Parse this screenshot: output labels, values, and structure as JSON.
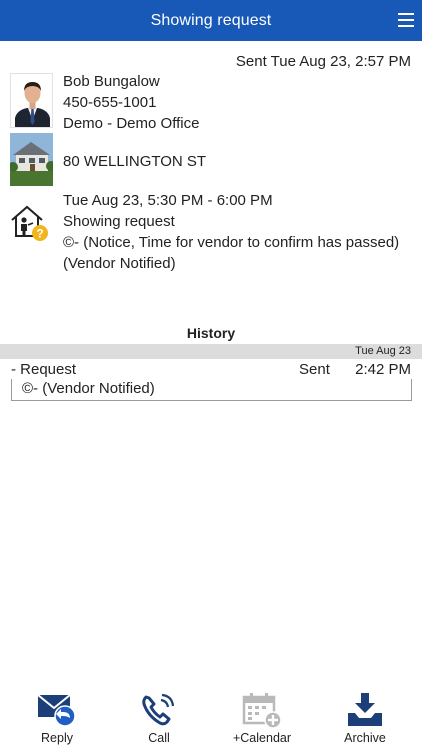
{
  "header": {
    "title": "Showing request",
    "menu_icon": "hamburger-menu-icon"
  },
  "sent": "Sent Tue Aug 23, 2:57 PM",
  "agent": {
    "name": "Bob Bungalow",
    "phone": "450-655-1001",
    "office": "Demo - Demo Office"
  },
  "property": {
    "address": "80 WELLINGTON ST"
  },
  "appointment": {
    "time": "Tue Aug 23, 5:30 PM - 6:00 PM",
    "type": "Showing request",
    "notice": "©- (Notice, Time for vendor to confirm has passed) (Vendor Notified)"
  },
  "history": {
    "title": "History",
    "date": "Tue Aug 23",
    "entries": [
      {
        "label": "- Request",
        "status": "Sent",
        "time": "2:42 PM",
        "detail": "©- (Vendor Notified)"
      }
    ]
  },
  "tabs": [
    {
      "label": "Reply",
      "icon": "reply-mail-icon"
    },
    {
      "label": "Call",
      "icon": "phone-call-icon"
    },
    {
      "label": "+Calendar",
      "icon": "calendar-add-icon"
    },
    {
      "label": "Archive",
      "icon": "archive-download-icon"
    }
  ],
  "colors": {
    "header_bg": "#1858b6",
    "icon_blue": "#1c3f7a",
    "accent_yellow": "#f2b51d",
    "history_bar": "#dcdcdc"
  }
}
